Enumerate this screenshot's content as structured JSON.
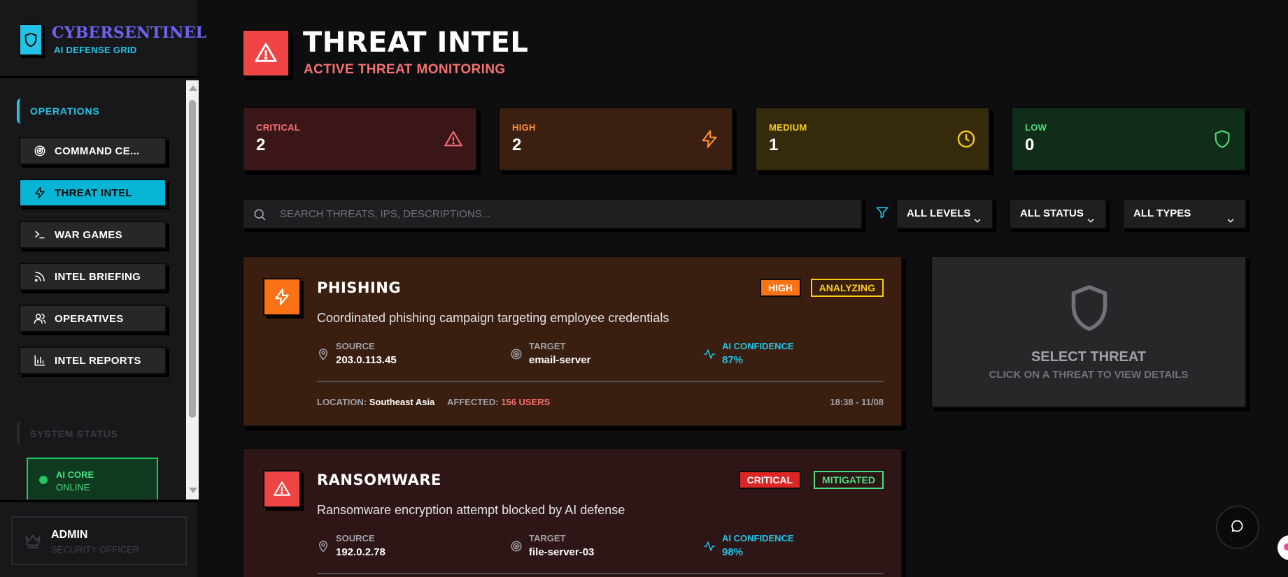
{
  "brand": {
    "name": "CYBERSENTINEL",
    "subtitle": "AI DEFENSE GRID"
  },
  "sidebar": {
    "section_operations": "OPERATIONS",
    "items": [
      {
        "label": "COMMAND CE...",
        "icon": "radar-icon",
        "active": false
      },
      {
        "label": "THREAT INTEL",
        "icon": "zap-icon",
        "active": true
      },
      {
        "label": "WAR GAMES",
        "icon": "terminal-icon",
        "active": false
      },
      {
        "label": "INTEL BRIEFING",
        "icon": "rss-icon",
        "active": false
      },
      {
        "label": "OPERATIVES",
        "icon": "users-icon",
        "active": false
      },
      {
        "label": "INTEL REPORTS",
        "icon": "bar-chart-icon",
        "active": false
      }
    ],
    "section_status": "SYSTEM STATUS",
    "status": {
      "line1": "AI CORE",
      "line2": "ONLINE"
    },
    "user": {
      "name": "ADMIN",
      "role": "SECURITY OFFICER"
    }
  },
  "header": {
    "title": "THREAT INTEL",
    "subtitle": "ACTIVE THREAT MONITORING"
  },
  "stats": [
    {
      "label": "CRITICAL",
      "value": "2",
      "icon": "alert-triangle-icon",
      "color": "#f87171",
      "bg": "#3a1619"
    },
    {
      "label": "HIGH",
      "value": "2",
      "icon": "zap-icon",
      "color": "#fb923c",
      "bg": "#3b1f10"
    },
    {
      "label": "MEDIUM",
      "value": "1",
      "icon": "clock-icon",
      "color": "#facc15",
      "bg": "#352a0c"
    },
    {
      "label": "LOW",
      "value": "0",
      "icon": "shield-icon",
      "color": "#4ade80",
      "bg": "#0f2d18"
    }
  ],
  "filters": {
    "search_placeholder": "SEARCH THREATS, IPS, DESCRIPTIONS...",
    "levels": "ALL LEVELS",
    "status": "ALL STATUS",
    "types": "ALL TYPES"
  },
  "labels": {
    "source": "SOURCE",
    "target": "TARGET",
    "ai_confidence": "AI CONFIDENCE",
    "location": "LOCATION:",
    "affected": "AFFECTED:"
  },
  "threats": [
    {
      "name": "PHISHING",
      "level": "HIGH",
      "status": "ANALYZING",
      "description": "Coordinated phishing campaign targeting employee credentials",
      "source": "203.0.113.45",
      "target": "email-server",
      "confidence": "87%",
      "location": "Southeast Asia",
      "affected": "156 USERS",
      "time": "18:38 - 11/08"
    },
    {
      "name": "RANSOMWARE",
      "level": "CRITICAL",
      "status": "MITIGATED",
      "description": "Ransomware encryption attempt blocked by AI defense",
      "source": "192.0.2.78",
      "target": "file-server-03",
      "confidence": "98%"
    }
  ],
  "detail": {
    "title": "SELECT THREAT",
    "subtitle": "CLICK ON A THREAT TO VIEW DETAILS"
  },
  "colors": {
    "accent": "#22c3e6",
    "brand": "#6e63f0",
    "critical": "#ef4444",
    "high": "#f97316"
  }
}
